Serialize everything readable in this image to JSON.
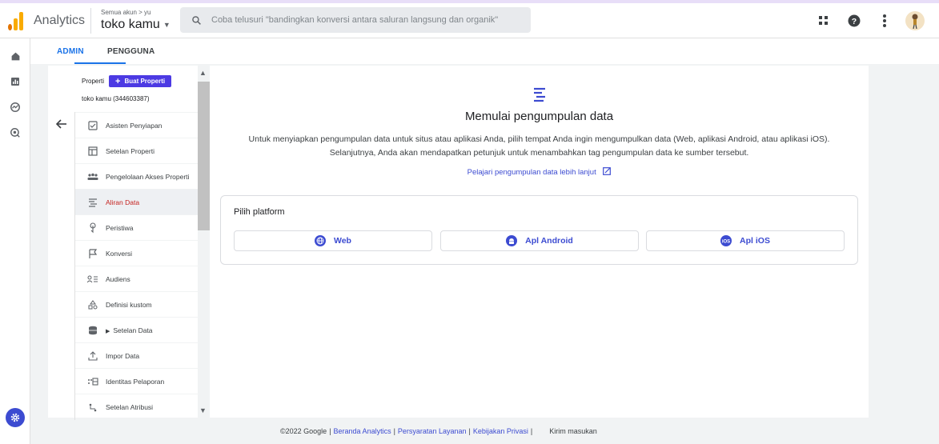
{
  "app": {
    "name": "Analytics",
    "account_crumb": "Semua akun > yu",
    "property_name": "toko kamu"
  },
  "search": {
    "placeholder": "Coba telusuri \"bandingkan konversi antara saluran langsung dan organik\""
  },
  "topbar_icons": [
    "apps-grid-icon",
    "help-icon",
    "more-vert-icon",
    "avatar"
  ],
  "leftnav_icons": [
    "home-icon",
    "reports-icon",
    "explore-icon",
    "advertising-icon",
    "admin-gear-icon"
  ],
  "tabs": [
    {
      "label": "ADMIN",
      "active": true
    },
    {
      "label": "PENGGUNA",
      "active": false
    }
  ],
  "property_panel": {
    "label": "Properti",
    "create_button": "Buat Properti",
    "property_id": "toko kamu (344603387)",
    "items": [
      {
        "label": "Asisten Penyiapan",
        "icon": "checkbox-icon",
        "active": false
      },
      {
        "label": "Setelan Properti",
        "icon": "property-settings-icon",
        "active": false
      },
      {
        "label": "Pengelolaan Akses Properti",
        "icon": "people-icon",
        "active": false
      },
      {
        "label": "Aliran Data",
        "icon": "data-stream-icon",
        "active": true
      },
      {
        "label": "Peristiwa",
        "icon": "touch-icon",
        "active": false
      },
      {
        "label": "Konversi",
        "icon": "flag-icon",
        "active": false
      },
      {
        "label": "Audiens",
        "icon": "audience-icon",
        "active": false
      },
      {
        "label": "Definisi kustom",
        "icon": "shapes-icon",
        "active": false
      },
      {
        "label": "Setelan Data",
        "icon": "database-icon",
        "active": false
      },
      {
        "label": "Impor Data",
        "icon": "upload-icon",
        "active": false
      },
      {
        "label": "Identitas Pelaporan",
        "icon": "identity-icon",
        "active": false
      },
      {
        "label": "Setelan Atribusi",
        "icon": "attribution-icon",
        "active": false
      }
    ]
  },
  "main": {
    "title": "Memulai pengumpulan data",
    "description": "Untuk menyiapkan pengumpulan data untuk situs atau aplikasi Anda, pilih tempat Anda ingin mengumpulkan data (Web, aplikasi Android, atau aplikasi iOS). Selanjutnya, Anda akan mendapatkan petunjuk untuk menambahkan tag pengumpulan data ke sumber tersebut.",
    "learn_more_link": "Pelajari pengumpulan data lebih lanjut",
    "platform_title": "Pilih platform",
    "platforms": [
      {
        "label": "Web",
        "icon": "globe-icon"
      },
      {
        "label": "Apl Android",
        "icon": "android-icon"
      },
      {
        "label": "Apl iOS",
        "icon": "ios-icon"
      }
    ]
  },
  "footer": {
    "copyright": "©2022 Google",
    "links": [
      "Beranda Analytics",
      "Persyaratan Layanan",
      "Kebijakan Privasi"
    ],
    "separator": "|",
    "feedback": "Kirim masukan"
  },
  "colors": {
    "accent": "#3c4bd1",
    "tab_active": "#1a73e8",
    "active_item_text": "#c5221f",
    "logo_orange": "#f9ab00",
    "logo_dark": "#e37400"
  }
}
